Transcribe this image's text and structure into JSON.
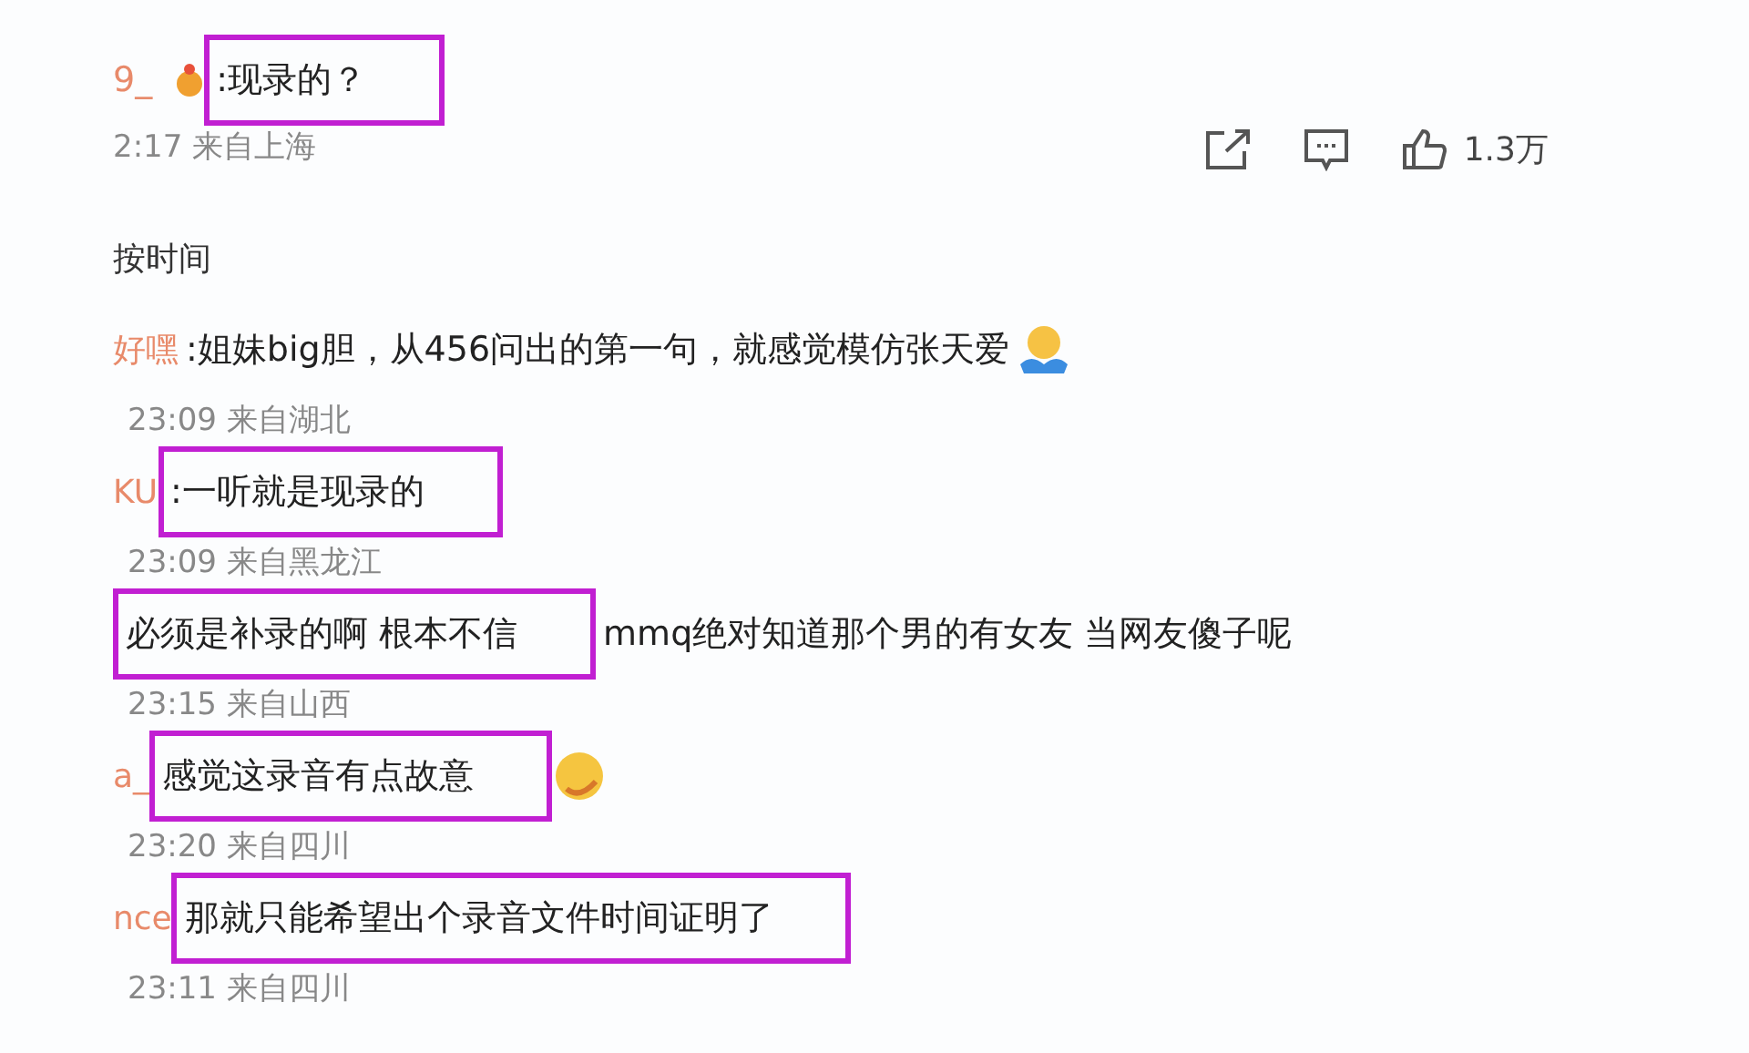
{
  "top_comment": {
    "name": "9_",
    "badge": true,
    "segments": [
      {
        "text": ":现录的？",
        "highlighted": true
      }
    ],
    "meta": "2:17 来自上海",
    "actions": {
      "likes": "1.3万"
    }
  },
  "sort_label": "按时间",
  "comments": [
    {
      "name": "好嘿",
      "segments": [
        {
          "text": ":姐妹big胆，从456问出的第一句，就感觉模仿张天爱",
          "highlighted": false
        }
      ],
      "emoji": {
        "kind": "shrug"
      },
      "meta": "23:09 来自湖北"
    },
    {
      "name": "KU",
      "segments": [
        {
          "text": ":一听就是现录的",
          "highlighted": true
        }
      ],
      "meta": "23:09 来自黑龙江"
    },
    {
      "segments": [
        {
          "text": "必须是补录的啊 根本不信",
          "highlighted": true
        },
        {
          "text": "mmq绝对知道那个男的有女友  当网友傻子呢",
          "highlighted": false
        }
      ],
      "meta": "23:15 来自山西"
    },
    {
      "name": "a_",
      "segments": [
        {
          "text": "感觉这录音有点故意",
          "highlighted": true
        }
      ],
      "emoji": {
        "kind": "smile"
      },
      "meta": "23:20 来自四川"
    },
    {
      "name": "nce",
      "segments": [
        {
          "text": "那就只能希望出个录音文件时间证明了",
          "highlighted": true
        }
      ],
      "meta": "23:11 来自四川"
    }
  ]
}
